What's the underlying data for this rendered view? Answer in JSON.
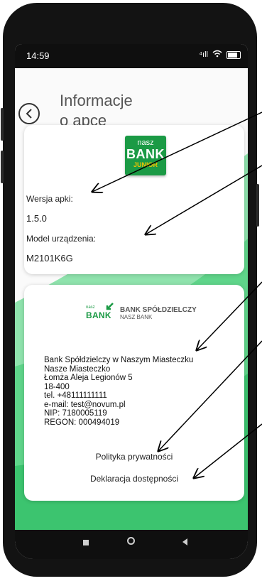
{
  "status_bar": {
    "time": "14:59",
    "signal_label": "⁴ıll"
  },
  "header": {
    "title_line1": "Informacje",
    "title_line2": "o apce"
  },
  "app_logo": {
    "line1": "nasz",
    "line2": "BANK",
    "line3": "JUNIOR"
  },
  "app_info": {
    "version_label": "Wersja apki:",
    "version_value": "1.5.0",
    "device_label": "Model urządzenia:",
    "device_value": "M2101K6G"
  },
  "bank_logo": {
    "small": "nasz",
    "big": "BANK",
    "name_line1": "BANK SPÓŁDZIELCZY",
    "name_line2": "NASZ BANK"
  },
  "bank_info": {
    "lines": [
      "Bank Spółdzielczy  w Naszym Miasteczku",
      "Nasze Miasteczko",
      "Łomża Aleja Legionów 5",
      "18-400",
      "tel. +48111111111",
      "e-mail: test@novum.pl",
      "NIP: 7180005119",
      "REGON: 000494019"
    ]
  },
  "links": {
    "privacy": "Polityka prywatności",
    "accessibility": "Deklaracja dostępności"
  },
  "colors": {
    "brand_green": "#1b9a45",
    "background_green": "#5fd58a"
  }
}
